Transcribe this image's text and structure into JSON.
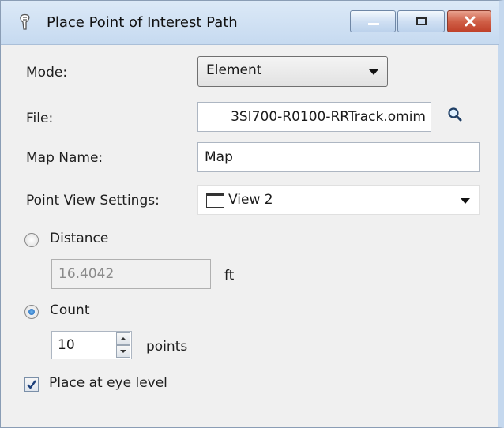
{
  "window": {
    "title": "Place Point of Interest Path"
  },
  "icons": {
    "app": "pin-icon",
    "minimize": "minimize-icon",
    "maximize": "maximize-icon",
    "close": "close-icon",
    "browse": "magnifier-icon",
    "view": "view-window-icon"
  },
  "form": {
    "mode_label": "Mode:",
    "mode_value": "Element",
    "file_label": "File:",
    "file_value": "3SI700-R0100-RRTrack.omim",
    "map_name_label": "Map Name:",
    "map_name_value": "Map",
    "point_view_label": "Point View Settings:",
    "point_view_value": "View 2",
    "distance_label": "Distance",
    "distance_value": "16.4042",
    "distance_unit": "ft",
    "count_label": "Count",
    "count_value": "10",
    "count_unit": "points",
    "eye_level_label": "Place at eye level"
  },
  "state": {
    "spacing_mode": "Count",
    "distance_enabled": false,
    "place_at_eye_level": true
  },
  "colors": {
    "title_bar": "#c6daf0",
    "window_border": "#8a9db5",
    "close_button": "#c7462f",
    "panel_bg": "#f0f0f0"
  }
}
